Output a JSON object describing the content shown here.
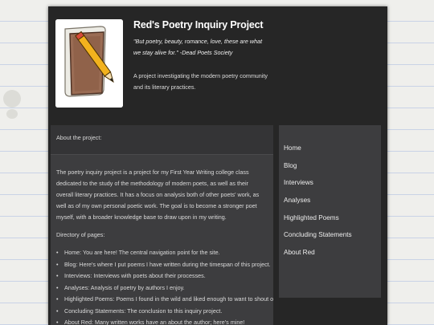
{
  "site": {
    "title": "Red's Poetry Inquiry Project",
    "tagline": "\"But poetry, beauty, romance, love, these are what we stay alive for.\" -Dead Poets Society",
    "description": "A project investigating the modern poetry community and its literary practices."
  },
  "content": {
    "header": "About the project:",
    "intro": "The poetry inquiry project is a project for my First Year Writing college class dedicated to the study of the methodology of modern poets, as well as their overall literary practices. It has a focus on analysis both of other poets' work, as well as of my own personal poetic work. The goal is to become a stronger poet myself, with a broader knowledge base to draw upon in my writing.",
    "directory_heading": "Directory of pages:",
    "directory": [
      "Home: You are here! The central navigation point for the site.",
      "Blog: Here's where I put poems I have written during the timespan of this project.",
      "Interviews: Interviews with poets about their processes.",
      "Analyses: Analysis of poetry by authors I enjoy.",
      "Highlighted Poems: Poems I found in the wild and liked enough to want to shout out.",
      "Concluding Statements: The conclusion to this inquiry project.",
      "About Red: Many written works have an about the author; here's mine!"
    ]
  },
  "nav": {
    "items": [
      "Home",
      "Blog",
      "Interviews",
      "Analyses",
      "Highlighted Poems",
      "Concluding Statements",
      "About Red"
    ]
  },
  "colors": {
    "background": "#efefec",
    "page": "#262626",
    "panel": "#3d3d3f",
    "text": "#dadada"
  },
  "icons": {
    "logo": "notepad-pencil-icon"
  }
}
